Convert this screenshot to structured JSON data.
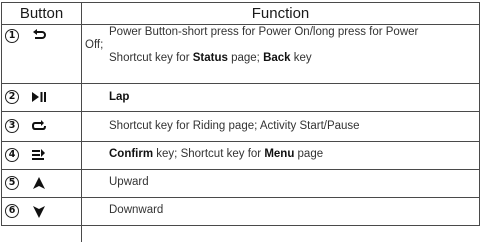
{
  "header": {
    "button": "Button",
    "function": "Function"
  },
  "rows": [
    {
      "num": "1",
      "icon": "back-arrow-icon",
      "line1": "Power Button-short press for Power On/long press for Power",
      "line2": "Off;",
      "line3_a": "Shortcut key for ",
      "line3_b": "Status",
      "line3_c": " page; ",
      "line3_d": "Back",
      "line3_e": " key"
    },
    {
      "num": "2",
      "icon": "play-pause-icon",
      "text_bold": "Lap"
    },
    {
      "num": "3",
      "icon": "loop-icon",
      "text": "Shortcut key for Riding page; Activity Start/Pause"
    },
    {
      "num": "4",
      "icon": "menu-confirm-icon",
      "text_a": "Confirm",
      "text_b": " key; Shortcut key for ",
      "text_c": "Menu",
      "text_d": " page"
    },
    {
      "num": "5",
      "icon": "up-triangle-icon",
      "text": "Upward"
    },
    {
      "num": "6",
      "icon": "down-triangle-icon",
      "text": "Downward"
    }
  ]
}
